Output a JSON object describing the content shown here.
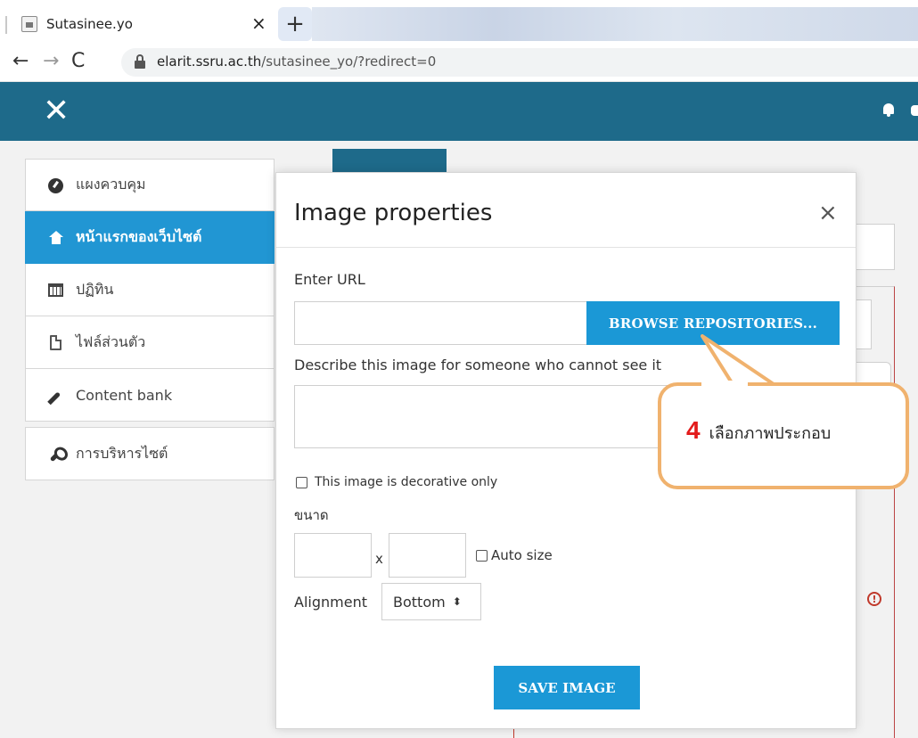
{
  "browser": {
    "tab_title": "Sutasinee.yo",
    "tab_close": "×",
    "new_tab": "+",
    "nav_back": "←",
    "nav_forward": "→",
    "nav_reload": "C",
    "url_host": "elarit.ssru.ac.th",
    "url_path": "/sutasinee_yo/?redirect=0"
  },
  "navbar": {
    "close_glyph": "✕",
    "icons": [
      "close-icon",
      "bell-icon"
    ]
  },
  "sidebar": {
    "items": [
      {
        "label": "แผงควบคุม",
        "icon": "dashboard-icon"
      },
      {
        "label": "หน้าแรกของเว็บไซต์",
        "icon": "home-icon",
        "active": true
      },
      {
        "label": "ปฏิทิน",
        "icon": "calendar-icon"
      },
      {
        "label": "ไฟล์ส่วนตัว",
        "icon": "file-icon"
      },
      {
        "label": "Content bank",
        "icon": "brush-icon"
      },
      {
        "label": "การบริหารไซต์",
        "icon": "wrench-icon"
      }
    ]
  },
  "modal": {
    "title": "Image properties",
    "close_glyph": "×",
    "url_label": "Enter URL",
    "url_value": "",
    "browse_button": "BROWSE REPOSITORIES...",
    "describe_label": "Describe this image for someone who cannot see it",
    "describe_value": "",
    "decorative_label": "This image is decorative only",
    "size_label": "ขนาด",
    "size_separator": "x",
    "width_value": "",
    "height_value": "",
    "autosize_label": "Auto size",
    "alignment_label": "Alignment",
    "alignment_value": "Bottom",
    "alignment_caret": "⬍",
    "save_button": "SAVE IMAGE"
  },
  "callout": {
    "number": "4",
    "text": "เลือกภาพประกอบ"
  },
  "colors": {
    "navbar": "#1e6a8a",
    "primary_button": "#1b98d6",
    "active_sidebar": "#2196d3",
    "callout_border": "#f0b26e",
    "callout_number": "#e31b1b"
  }
}
